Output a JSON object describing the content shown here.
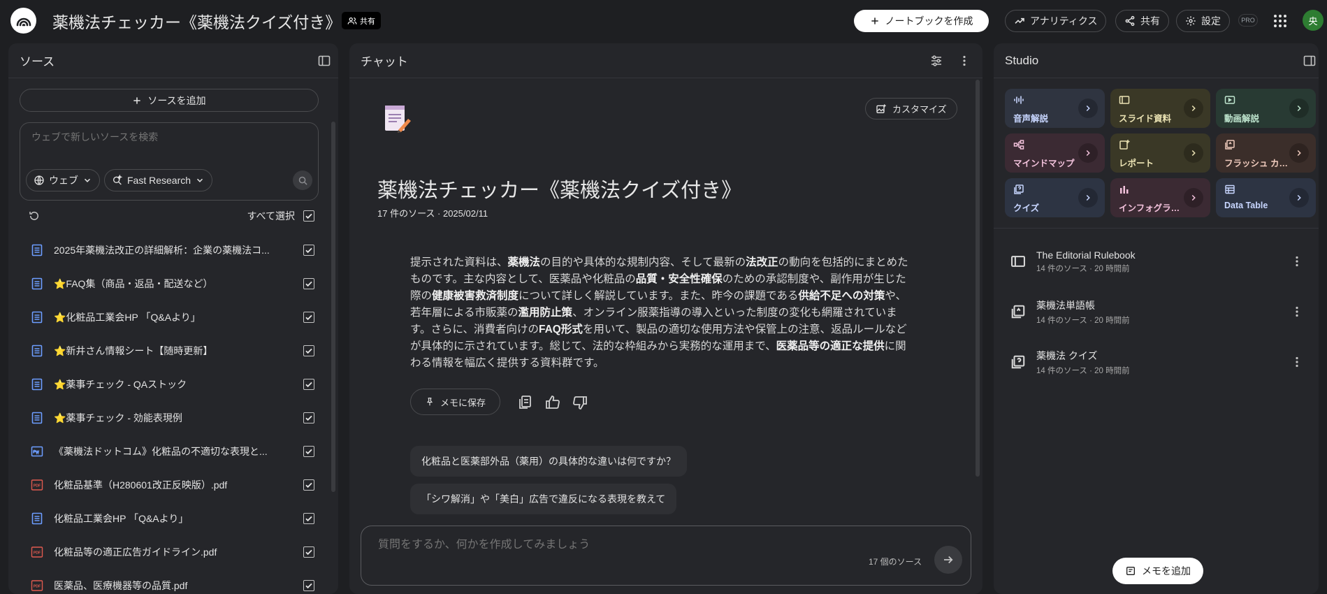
{
  "header": {
    "title": "薬機法チェッカー《薬機法クイズ付き》",
    "share_chip": "共有",
    "create_notebook": "ノートブックを作成",
    "analytics": "アナリティクス",
    "share": "共有",
    "settings": "設定",
    "pro_badge": "PRO",
    "avatar_initial": "央"
  },
  "sources": {
    "title": "ソース",
    "add_button": "ソースを追加",
    "search_placeholder": "ウェブで新しいソースを検索",
    "web_dropdown": "ウェブ",
    "research_dropdown": "Fast Research",
    "select_all": "すべて選択",
    "items": [
      {
        "name": "2025年薬機法改正の詳細解析：企業の薬機法コ...",
        "type": "doc"
      },
      {
        "name": "⭐FAQ集（商品・返品・配送など）",
        "type": "doc"
      },
      {
        "name": "⭐化粧品工業会HP 「Q&Aより」",
        "type": "doc"
      },
      {
        "name": "⭐新井さん情報シート【随時更新】",
        "type": "doc"
      },
      {
        "name": "⭐薬事チェック - QAストック",
        "type": "doc"
      },
      {
        "name": "⭐薬事チェック - 効能表現例",
        "type": "doc"
      },
      {
        "name": "《薬機法ドットコム》化粧品の不適切な表現と...",
        "type": "web"
      },
      {
        "name": "化粧品基準（H280601改正反映版）.pdf",
        "type": "pdf"
      },
      {
        "name": "化粧品工業会HP 「Q&Aより」",
        "type": "doc"
      },
      {
        "name": "化粧品等の適正広告ガイドライン.pdf",
        "type": "pdf"
      },
      {
        "name": "医薬品、医療機器等の品質.pdf",
        "type": "pdf"
      }
    ]
  },
  "chat": {
    "title": "チャット",
    "customize": "カスタマイズ",
    "notebook_title": "薬機法チェッカー《薬機法クイズ付き》",
    "notebook_meta": "17 件のソース · 2025/02/11",
    "summary_parts": [
      {
        "t": "提示された資料は、",
        "b": false
      },
      {
        "t": "薬機法",
        "b": true
      },
      {
        "t": "の目的や具体的な規制内容、そして最新の",
        "b": false
      },
      {
        "t": "法改正",
        "b": true
      },
      {
        "t": "の動向を包括的にまとめたものです。主な内容として、医薬品や化粧品の",
        "b": false
      },
      {
        "t": "品質・安全性確保",
        "b": true
      },
      {
        "t": "のための承認制度や、副作用が生じた際の",
        "b": false
      },
      {
        "t": "健康被害救済制度",
        "b": true
      },
      {
        "t": "について詳しく解説しています。また、昨今の課題である",
        "b": false
      },
      {
        "t": "供給不足への対策",
        "b": true
      },
      {
        "t": "や、若年層による市販薬の",
        "b": false
      },
      {
        "t": "濫用防止策",
        "b": true
      },
      {
        "t": "、オンライン服薬指導の導入といった制度の変化も網羅されています。さらに、消費者向けの",
        "b": false
      },
      {
        "t": "FAQ形式",
        "b": true
      },
      {
        "t": "を用いて、製品の適切な使用方法や保管上の注意、返品ルールなどが具体的に示されています。総じて、法的な枠組みから実務的な運用まで、",
        "b": false
      },
      {
        "t": "医薬品等の適正な提供",
        "b": true
      },
      {
        "t": "に関わる情報を幅広く提供する資料群です。",
        "b": false
      }
    ],
    "save_memo": "メモに保存",
    "suggestions": [
      "化粧品と医薬部外品（薬用）の具体的な違いは何ですか？",
      "「シワ解消」や「美白」広告で違反になる表現を教えて"
    ],
    "input_placeholder": "質問をするか、何かを作成してみましょう",
    "source_count": "17 個のソース"
  },
  "studio": {
    "title": "Studio",
    "tiles": [
      {
        "label": "音声解説",
        "icon": "audio-wave-icon",
        "bg": "#2f3440",
        "fg": "#c8d6ff"
      },
      {
        "label": "スライド資料",
        "icon": "slides-icon",
        "bg": "#3a3826",
        "fg": "#ebe3b4"
      },
      {
        "label": "動画解説",
        "icon": "video-icon",
        "bg": "#283a33",
        "fg": "#bfe6cf"
      },
      {
        "label": "マインドマップ",
        "icon": "mindmap-icon",
        "bg": "#3b2a33",
        "fg": "#f3c2dc"
      },
      {
        "label": "レポート",
        "icon": "report-icon",
        "bg": "#3a3826",
        "fg": "#ebe3b4"
      },
      {
        "label": "フラッシュ カード",
        "icon": "flashcard-icon",
        "bg": "#3b2e2a",
        "fg": "#f0cbbd"
      },
      {
        "label": "クイズ",
        "icon": "quiz-icon",
        "bg": "#2d3443",
        "fg": "#c8d6ff"
      },
      {
        "label": "インフォグラフィック",
        "icon": "infographic-icon",
        "bg": "#3b2a33",
        "fg": "#f3c2dc"
      },
      {
        "label": "Data Table",
        "icon": "table-icon",
        "bg": "#2d3443",
        "fg": "#c8d6ff"
      }
    ],
    "notes": [
      {
        "title": "The Editorial Rulebook",
        "meta": "14 件のソース · 20 時間前",
        "icon": "slides-icon"
      },
      {
        "title": "薬機法単語帳",
        "meta": "14 件のソース · 20 時間前",
        "icon": "flashcard-icon"
      },
      {
        "title": "薬機法 クイズ",
        "meta": "14 件のソース · 20 時間前",
        "icon": "quiz-icon"
      }
    ],
    "add_memo": "メモを追加"
  },
  "colors": {
    "background": "#1e1f22",
    "panel": "#25262a",
    "doc_icon": "#6d9dff",
    "pdf_icon": "#e05a4f"
  }
}
